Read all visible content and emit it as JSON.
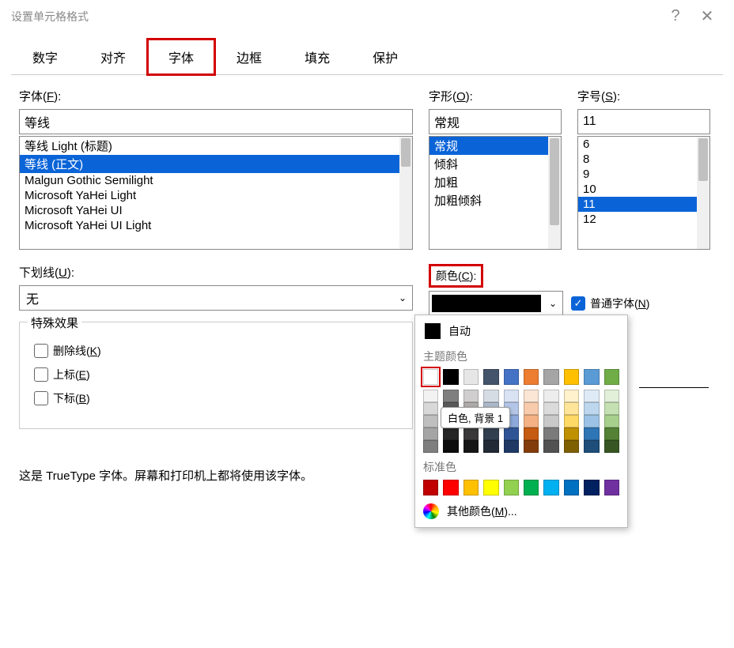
{
  "title": "设置单元格格式",
  "tabs": [
    "数字",
    "对齐",
    "字体",
    "边框",
    "填充",
    "保护"
  ],
  "active_tab": "字体",
  "font": {
    "label": "字体(F):",
    "value": "等线",
    "list": [
      "等线 Light (标题)",
      "等线 (正文)",
      "Malgun Gothic Semilight",
      "Microsoft YaHei Light",
      "Microsoft YaHei UI",
      "Microsoft YaHei UI Light"
    ],
    "selected_index": 1
  },
  "style": {
    "label": "字形(O):",
    "value": "常规",
    "list": [
      "常规",
      "倾斜",
      "加粗",
      "加粗倾斜"
    ],
    "selected_index": 0
  },
  "size": {
    "label": "字号(S):",
    "value": "11",
    "list": [
      "6",
      "8",
      "9",
      "10",
      "11",
      "12"
    ],
    "selected_index": 4
  },
  "underline": {
    "label": "下划线(U):",
    "value": "无"
  },
  "color": {
    "label": "颜色(C):"
  },
  "normal_font": {
    "label": "普通字体(N)",
    "checked": true
  },
  "effects": {
    "legend": "特殊效果",
    "strike": "删除线(K)",
    "superscript": "上标(E)",
    "subscript": "下标(B)"
  },
  "color_popup": {
    "auto": "自动",
    "theme_label": "主题颜色",
    "theme_row": [
      "#ffffff",
      "#000000",
      "#e7e6e6",
      "#44546a",
      "#4472c4",
      "#ed7d31",
      "#a5a5a5",
      "#ffc000",
      "#5b9bd5",
      "#70ad47"
    ],
    "tint_rows": [
      [
        "#f2f2f2",
        "#7f7f7f",
        "#d0cece",
        "#d6dce4",
        "#d9e2f3",
        "#fbe5d5",
        "#ededed",
        "#fff2cc",
        "#deebf6",
        "#e2efd9"
      ],
      [
        "#d8d8d8",
        "#595959",
        "#aeabab",
        "#adb9ca",
        "#b4c6e7",
        "#f7cbac",
        "#dbdbdb",
        "#fee599",
        "#bdd7ee",
        "#c5e0b3"
      ],
      [
        "#bfbfbf",
        "#3f3f3f",
        "#757070",
        "#8496b0",
        "#8eaadb",
        "#f4b183",
        "#c9c9c9",
        "#ffd965",
        "#9cc3e5",
        "#a8d08d"
      ],
      [
        "#a5a5a5",
        "#262626",
        "#3a3838",
        "#323f4f",
        "#2f5496",
        "#c55a11",
        "#7b7b7b",
        "#bf9000",
        "#2e75b5",
        "#538135"
      ],
      [
        "#7f7f7f",
        "#0c0c0c",
        "#171616",
        "#222a35",
        "#1f3864",
        "#833c0b",
        "#525252",
        "#7f6000",
        "#1e4e79",
        "#375623"
      ]
    ],
    "std_label": "标准色",
    "std_row": [
      "#c00000",
      "#ff0000",
      "#ffc000",
      "#ffff00",
      "#92d050",
      "#00b050",
      "#00b0f0",
      "#0070c0",
      "#002060",
      "#7030a0"
    ],
    "tooltip": "白色, 背景 1",
    "more": "其他颜色(M)..."
  },
  "description": "这是 TrueType 字体。屏幕和打印机上都将使用该字体。"
}
